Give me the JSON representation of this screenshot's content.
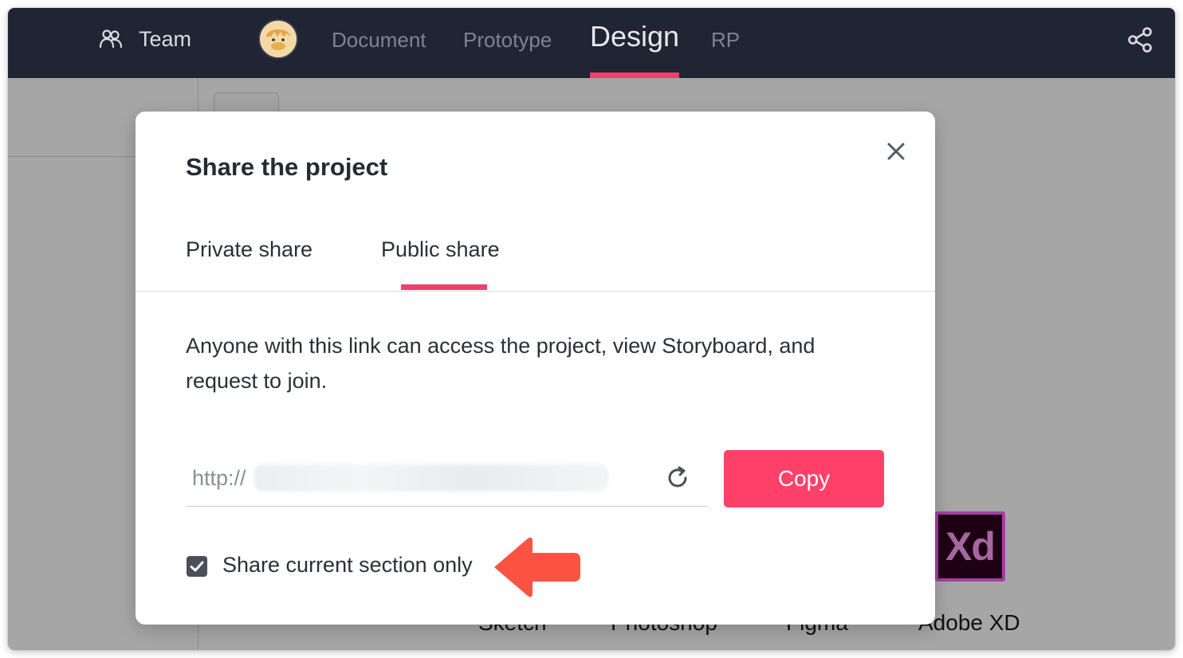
{
  "topnav": {
    "team_label": "Team",
    "tabs": [
      {
        "label": "Document",
        "active": false
      },
      {
        "label": "Prototype",
        "active": false
      },
      {
        "label": "Design",
        "active": true
      },
      {
        "label": "RP",
        "active": false
      }
    ],
    "active_color": "#f0406a"
  },
  "background": {
    "tool_labels": [
      "Sketch",
      "Photoshop",
      "Figma",
      "Adobe XD"
    ],
    "xd_badge": "Xd"
  },
  "modal": {
    "title": "Share the project",
    "tabs": {
      "private": "Private share",
      "public": "Public share",
      "active": "public"
    },
    "description": "Anyone with this link can access the project, view Storyboard, and request to join.",
    "link_prefix": "http://",
    "copy_label": "Copy",
    "share_section_label": "Share current section only",
    "share_section_checked": true,
    "accent_color": "#ff4169"
  },
  "icons": {
    "team": "team-icon",
    "share": "share-icon",
    "close": "close-icon",
    "refresh": "refresh-icon",
    "check": "check-icon",
    "arrow": "arrow-left-icon"
  }
}
